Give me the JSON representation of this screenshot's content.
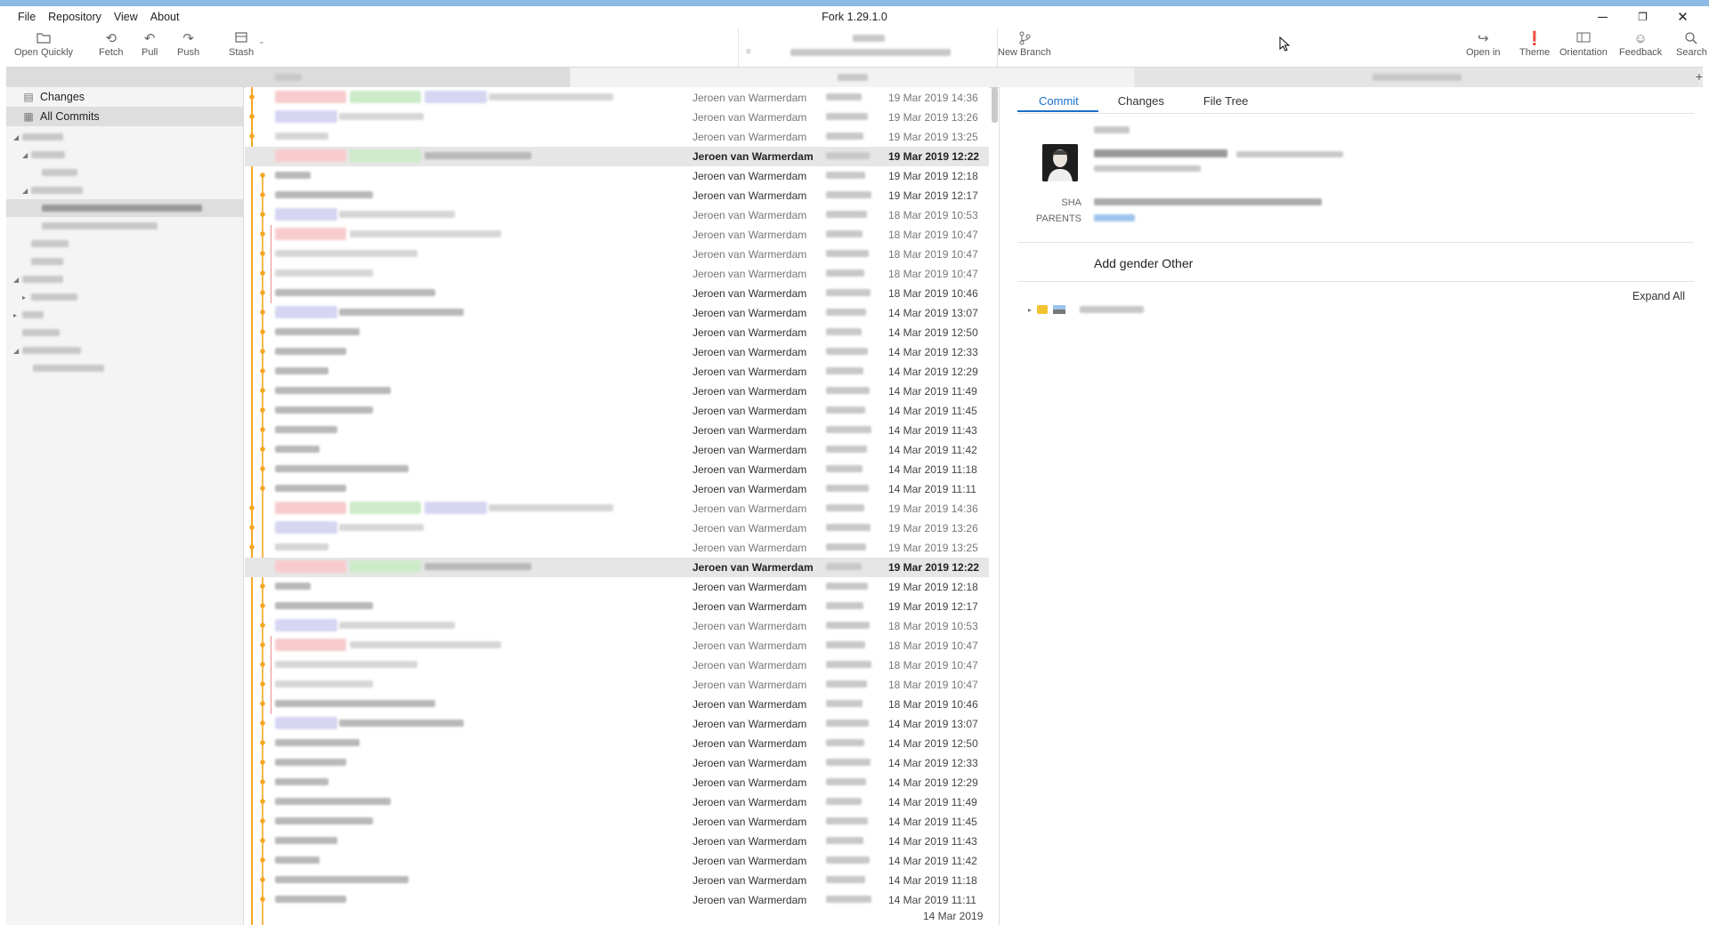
{
  "window": {
    "title": "Fork 1.29.1.0",
    "menu": [
      "File",
      "Repository",
      "View",
      "About"
    ],
    "controls": {
      "minimize": "─",
      "restore": "❐",
      "close": "✕"
    }
  },
  "toolbar": {
    "open_quickly": "Open Quickly",
    "fetch": "Fetch",
    "pull": "Pull",
    "push": "Push",
    "stash": "Stash",
    "new_branch": "New Branch",
    "open_in": "Open in",
    "theme": "Theme",
    "orientation": "Orientation",
    "feedback": "Feedback",
    "search": "Search"
  },
  "sidebar": {
    "changes": "Changes",
    "all_commits": "All Commits"
  },
  "commits": [
    {
      "author": "Jeroen van Warmerdam",
      "date": "19 Mar 2019 14:36",
      "dim": true,
      "tags": [
        "red",
        "green",
        "blue"
      ]
    },
    {
      "author": "Jeroen van Warmerdam",
      "date": "19 Mar 2019 13:26",
      "dim": true,
      "tags": [
        "blue"
      ]
    },
    {
      "author": "Jeroen van Warmerdam",
      "date": "19 Mar 2019 13:25",
      "dim": true,
      "tags": []
    },
    {
      "author": "Jeroen van Warmerdam",
      "date": "19 Mar 2019 12:22",
      "selected": true,
      "tags": [
        "red",
        "green"
      ]
    },
    {
      "author": "Jeroen van Warmerdam",
      "date": "19 Mar 2019 12:18",
      "tags": []
    },
    {
      "author": "Jeroen van Warmerdam",
      "date": "19 Mar 2019 12:17",
      "tags": []
    },
    {
      "author": "Jeroen van Warmerdam",
      "date": "18 Mar 2019 10:53",
      "dim": true,
      "tags": [
        "blue"
      ]
    },
    {
      "author": "Jeroen van Warmerdam",
      "date": "18 Mar 2019 10:47",
      "dim": true,
      "tags": [
        "red"
      ]
    },
    {
      "author": "Jeroen van Warmerdam",
      "date": "18 Mar 2019 10:47",
      "dim": true,
      "tags": []
    },
    {
      "author": "Jeroen van Warmerdam",
      "date": "18 Mar 2019 10:47",
      "dim": true,
      "tags": []
    },
    {
      "author": "Jeroen van Warmerdam",
      "date": "18 Mar 2019 10:46",
      "tags": []
    },
    {
      "author": "Jeroen van Warmerdam",
      "date": "14 Mar 2019 13:07",
      "tags": [
        "blue"
      ]
    },
    {
      "author": "Jeroen van Warmerdam",
      "date": "14 Mar 2019 12:50",
      "tags": []
    },
    {
      "author": "Jeroen van Warmerdam",
      "date": "14 Mar 2019 12:33",
      "tags": []
    },
    {
      "author": "Jeroen van Warmerdam",
      "date": "14 Mar 2019 12:29",
      "tags": []
    },
    {
      "author": "Jeroen van Warmerdam",
      "date": "14 Mar 2019 11:49",
      "tags": []
    },
    {
      "author": "Jeroen van Warmerdam",
      "date": "14 Mar 2019 11:45",
      "tags": []
    },
    {
      "author": "Jeroen van Warmerdam",
      "date": "14 Mar 2019 11:43",
      "tags": []
    },
    {
      "author": "Jeroen van Warmerdam",
      "date": "14 Mar 2019 11:42",
      "tags": []
    },
    {
      "author": "Jeroen van Warmerdam",
      "date": "14 Mar 2019 11:18",
      "tags": []
    },
    {
      "author": "Jeroen van Warmerdam",
      "date": "14 Mar 2019 11:11",
      "tags": []
    },
    {
      "author": "Jeroen van Warmerdam",
      "date": "19 Mar 2019 14:36",
      "dim": true,
      "tags": [
        "red",
        "green",
        "blue"
      ]
    },
    {
      "author": "Jeroen van Warmerdam",
      "date": "19 Mar 2019 13:26",
      "dim": true,
      "tags": [
        "blue"
      ]
    },
    {
      "author": "Jeroen van Warmerdam",
      "date": "19 Mar 2019 13:25",
      "dim": true,
      "tags": []
    },
    {
      "author": "Jeroen van Warmerdam",
      "date": "19 Mar 2019 12:22",
      "selected": true,
      "tags": [
        "red",
        "green"
      ]
    },
    {
      "author": "Jeroen van Warmerdam",
      "date": "19 Mar 2019 12:18",
      "tags": []
    },
    {
      "author": "Jeroen van Warmerdam",
      "date": "19 Mar 2019 12:17",
      "tags": []
    },
    {
      "author": "Jeroen van Warmerdam",
      "date": "18 Mar 2019 10:53",
      "dim": true,
      "tags": [
        "blue"
      ]
    },
    {
      "author": "Jeroen van Warmerdam",
      "date": "18 Mar 2019 10:47",
      "dim": true,
      "tags": [
        "red"
      ]
    },
    {
      "author": "Jeroen van Warmerdam",
      "date": "18 Mar 2019 10:47",
      "dim": true,
      "tags": []
    },
    {
      "author": "Jeroen van Warmerdam",
      "date": "18 Mar 2019 10:47",
      "dim": true,
      "tags": []
    },
    {
      "author": "Jeroen van Warmerdam",
      "date": "18 Mar 2019 10:46",
      "tags": []
    },
    {
      "author": "Jeroen van Warmerdam",
      "date": "14 Mar 2019 13:07",
      "tags": [
        "blue"
      ]
    },
    {
      "author": "Jeroen van Warmerdam",
      "date": "14 Mar 2019 12:50",
      "tags": []
    },
    {
      "author": "Jeroen van Warmerdam",
      "date": "14 Mar 2019 12:33",
      "tags": []
    },
    {
      "author": "Jeroen van Warmerdam",
      "date": "14 Mar 2019 12:29",
      "tags": []
    },
    {
      "author": "Jeroen van Warmerdam",
      "date": "14 Mar 2019 11:49",
      "tags": []
    },
    {
      "author": "Jeroen van Warmerdam",
      "date": "14 Mar 2019 11:45",
      "tags": []
    },
    {
      "author": "Jeroen van Warmerdam",
      "date": "14 Mar 2019 11:43",
      "tags": []
    },
    {
      "author": "Jeroen van Warmerdam",
      "date": "14 Mar 2019 11:42",
      "tags": []
    },
    {
      "author": "Jeroen van Warmerdam",
      "date": "14 Mar 2019 11:18",
      "tags": []
    },
    {
      "author": "Jeroen van Warmerdam",
      "date": "14 Mar 2019 11:11",
      "tags": []
    }
  ],
  "tooltip_date": "14 Mar 2019",
  "details": {
    "tabs": [
      "Commit",
      "Changes",
      "File Tree"
    ],
    "active_tab": "Commit",
    "sha_label": "SHA",
    "parents_label": "PARENTS",
    "subject": "Add gender Other",
    "expand_all": "Expand All"
  },
  "colors": {
    "accent": "#1a6fc9",
    "graph_main": "#f5a623",
    "graph_branch": "#e87070",
    "frame": "#7aaed6",
    "tag_red": "#f8cccc",
    "tag_green": "#cdebc9",
    "tag_blue": "#d6d6f3"
  },
  "icons": {
    "open_quickly": "folder-icon",
    "fetch": "fetch-icon",
    "pull": "pull-icon",
    "push": "push-icon",
    "stash": "stash-icon",
    "new_branch": "branch-icon",
    "open_in": "open-in-icon",
    "theme": "theme-icon",
    "orientation": "orientation-icon",
    "feedback": "smiley-icon",
    "search": "search-icon"
  }
}
